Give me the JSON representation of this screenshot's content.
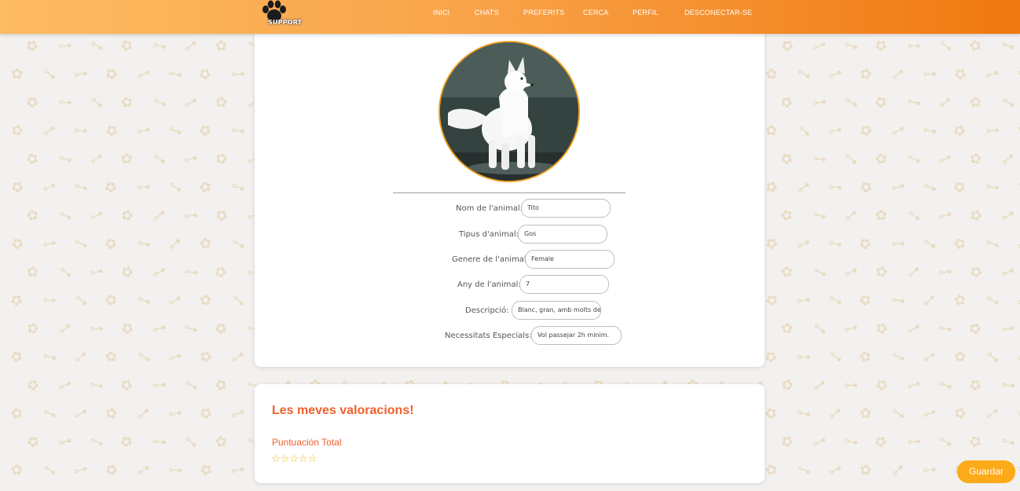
{
  "header": {
    "logo_text": "SUPPORT",
    "nav": [
      {
        "label": "INICI"
      },
      {
        "label": "CHATS"
      },
      {
        "label": "PREFERITS"
      },
      {
        "label": "CERCA"
      },
      {
        "label": "PERFIL"
      },
      {
        "label": "DESCONECTAR-SE"
      }
    ]
  },
  "profile": {
    "avatar_icon": "dog-photo",
    "fields": [
      {
        "label": "Nom de l'animal:",
        "value": "Tito"
      },
      {
        "label": "Tipus d'animal:",
        "value": "Gos"
      },
      {
        "label": "Genere de l'animal:",
        "value": "Female"
      },
      {
        "label": "Any de l'animal:",
        "value": "7"
      },
      {
        "label": "Descripció:",
        "value": "Blanc, gran, amb molts de"
      },
      {
        "label": "Necessitats Especials:",
        "value": "Vol passejar 2h minim."
      }
    ]
  },
  "ratings": {
    "title": "Les meves valoracions!",
    "total_label": "Puntuación Total",
    "stars_filled": 0,
    "stars_total": 5,
    "stars_text": "☆☆☆☆☆"
  },
  "actions": {
    "save_label": "Guardar"
  },
  "colors": {
    "accent": "#f0602c",
    "nav_gradient_start": "#fdbb62",
    "nav_gradient_end": "#f0780f",
    "button": "#fdaa18"
  }
}
